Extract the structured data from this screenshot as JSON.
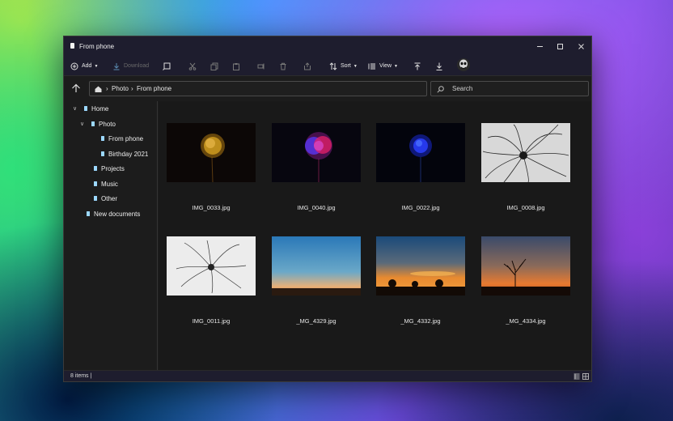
{
  "window": {
    "title": "From phone"
  },
  "toolbar": {
    "add_label": "Add",
    "download_label": "Download",
    "sort_label": "Sort",
    "view_label": "View"
  },
  "address": {
    "crumbs": [
      "Photo",
      "From phone"
    ]
  },
  "search": {
    "placeholder": "Search"
  },
  "sidebar": {
    "items": [
      {
        "label": "Home"
      },
      {
        "label": "Photo"
      },
      {
        "label": "From phone"
      },
      {
        "label": "Birthday 2021"
      },
      {
        "label": "Projects"
      },
      {
        "label": "Music"
      },
      {
        "label": "Other"
      },
      {
        "label": "New documents"
      }
    ]
  },
  "files": [
    {
      "name": "IMG_0033.jpg"
    },
    {
      "name": "IMG_0040.jpg"
    },
    {
      "name": "IMG_0022.jpg"
    },
    {
      "name": "IMG_0008.jpg"
    },
    {
      "name": "IMG_0011.jpg"
    },
    {
      "name": "_MG_4329.jpg"
    },
    {
      "name": "_MG_4332.jpg"
    },
    {
      "name": "_MG_4334.jpg"
    }
  ],
  "status": {
    "count": "8 items |"
  }
}
